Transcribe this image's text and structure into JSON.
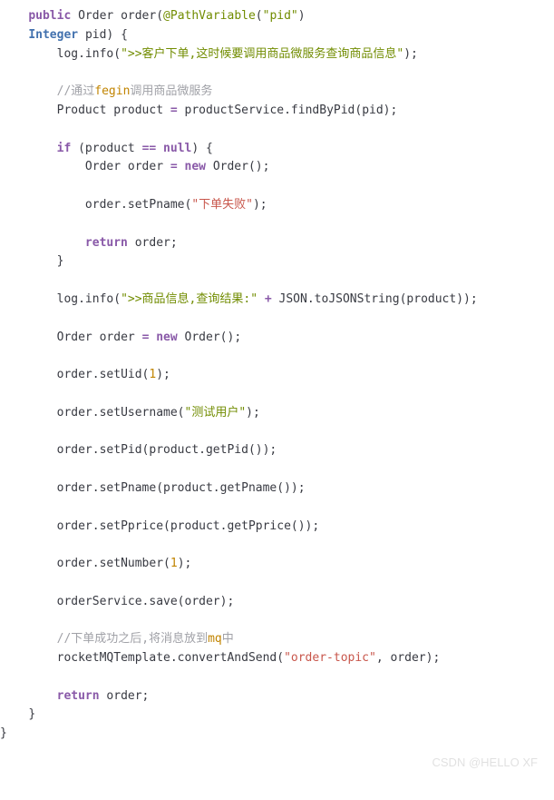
{
  "code": {
    "l01": {
      "kw_public": "public",
      "type_order": "Order",
      "meth_order": "order",
      "ann": "@PathVariable",
      "str_pid": "\"pid\"",
      "paren_close": ")"
    },
    "l02": {
      "type_integer": "Integer",
      "param": "pid) {"
    },
    "l03": {
      "obj": "log.info(",
      "str": "\">>客户下单,这时候要调用商品微服务查询商品信息\"",
      "end": ");"
    },
    "l05": {
      "pre": "//通过",
      "em": "fegin",
      "post": "调用商品微服务"
    },
    "l06": {
      "t1": "Product",
      "var": "product",
      "eq": "=",
      "t2": "productService.findByPid(pid);"
    },
    "l08": {
      "kw_if": "if",
      "open": "(product",
      "eq": "==",
      "kw_null": "null",
      "close": ") {"
    },
    "l09": {
      "t1": "Order",
      "v": "order",
      "eq": "=",
      "kw_new": "new",
      "t2": "Order",
      "tail": "();"
    },
    "l11": {
      "call": "order.setPname(",
      "str": "\"下单失败\"",
      "end": ");"
    },
    "l13": {
      "kw_return": "return",
      "v": "order;"
    },
    "l14": {
      "brace": "}"
    },
    "l16": {
      "call": "log.info(",
      "str": "\">>商品信息,查询结果:\"",
      "plus": "+",
      "tail": "JSON.toJSONString(product));"
    },
    "l18": {
      "t1": "Order",
      "v": "order",
      "eq": "=",
      "kw_new": "new",
      "t2": "Order",
      "tail": "();"
    },
    "l20": {
      "call": "order.setUid(",
      "num": "1",
      "end": ");"
    },
    "l22": {
      "call": "order.setUsername(",
      "str": "\"测试用户\"",
      "end": ");"
    },
    "l24": {
      "full": "order.setPid(product.getPid());"
    },
    "l26": {
      "full": "order.setPname(product.getPname());"
    },
    "l28": {
      "full": "order.setPprice(product.getPprice());"
    },
    "l30": {
      "call": "order.setNumber(",
      "num": "1",
      "end": ");"
    },
    "l32": {
      "full": "orderService.save(order);"
    },
    "l34": {
      "pre": "//下单成功之后,将消息放到",
      "em": "mq",
      "post": "中"
    },
    "l35": {
      "call": "rocketMQTemplate.convertAndSend(",
      "str": "\"order-topic\"",
      "mid": ",",
      "tail": " order);"
    },
    "l37": {
      "kw_return": "return",
      "v": "order;"
    },
    "l38": {
      "brace": "}"
    },
    "l39": {
      "brace": "}"
    }
  },
  "watermark": "CSDN @HELLO XF"
}
